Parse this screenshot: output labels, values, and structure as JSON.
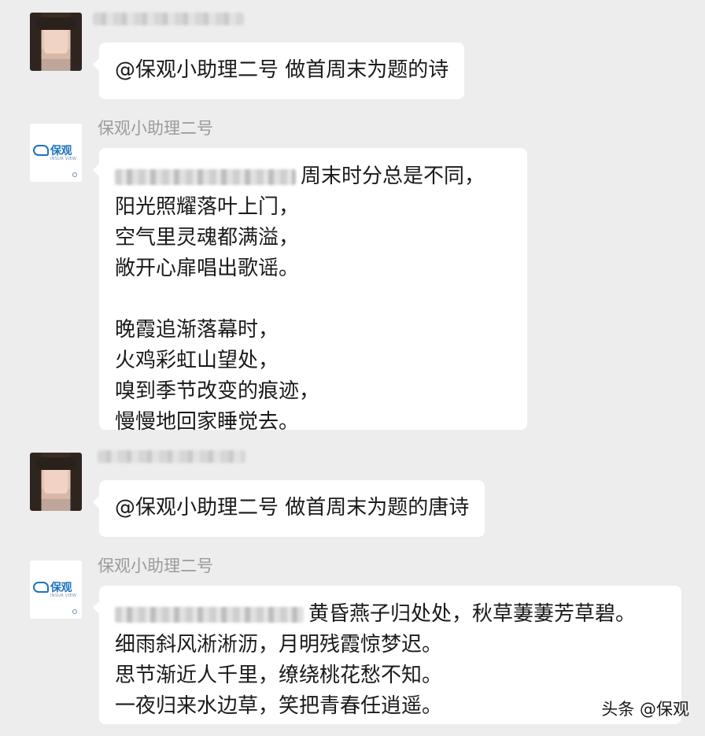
{
  "messages": [
    {
      "sender_type": "user",
      "text": "@保观小助理二号 做首周末为题的诗"
    },
    {
      "sender_type": "bot",
      "sender_name": "保观小助理二号",
      "lines": [
        "周末时分总是不同，",
        "阳光照耀落叶上门，",
        "空气里灵魂都满溢，",
        "敞开心扉唱出歌谣。",
        "晚霞追渐落幕时，",
        "火鸡彩虹山望处，",
        "嗅到季节改变的痕迹，",
        "慢慢地回家睡觉去。"
      ]
    },
    {
      "sender_type": "user",
      "text": "@保观小助理二号 做首周末为题的唐诗"
    },
    {
      "sender_type": "bot",
      "sender_name": "保观小助理二号",
      "lines": [
        "黄昏燕子归处处，秋草萋萋芳草碧。",
        "细雨斜风淅淅沥，月明残霞惊梦迟。",
        "思节渐近人千里，缭绕桃花愁不知。",
        "一夜归来水边草，笑把青春任逍遥。"
      ]
    }
  ],
  "bot_avatar": {
    "logo_text": "保观",
    "logo_subtext": "INSUR VIEW",
    "brand_color": "#1e73be"
  },
  "watermark": "头条 @保观",
  "colors": {
    "background": "#ededed",
    "bubble": "#ffffff",
    "sender_name": "#9b9b9b"
  }
}
